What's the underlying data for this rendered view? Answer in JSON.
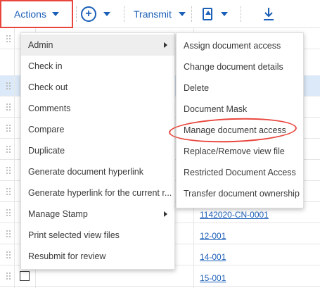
{
  "toolbar": {
    "actions_label": "Actions",
    "transmit_label": "Transmit"
  },
  "grid": {
    "document_links": [
      "1142020-CN-0001",
      "12-001",
      "14-001",
      "15-001"
    ]
  },
  "actions_menu": {
    "items": [
      {
        "label": "Admin"
      },
      {
        "label": "Check in"
      },
      {
        "label": "Check out"
      },
      {
        "label": "Comments"
      },
      {
        "label": "Compare"
      },
      {
        "label": "Duplicate"
      },
      {
        "label": "Generate document hyperlink"
      },
      {
        "label": "Generate hyperlink for the current r..."
      },
      {
        "label": "Manage Stamp"
      },
      {
        "label": "Print selected view files"
      },
      {
        "label": "Resubmit for review"
      }
    ]
  },
  "admin_submenu": {
    "items": [
      {
        "label": "Assign document access"
      },
      {
        "label": "Change document details"
      },
      {
        "label": "Delete"
      },
      {
        "label": "Document Mask"
      },
      {
        "label": "Manage document access"
      },
      {
        "label": "Replace/Remove view file"
      },
      {
        "label": "Restricted Document Access"
      },
      {
        "label": "Transfer document ownership"
      }
    ]
  },
  "colors": {
    "accent": "#1b5fb8",
    "highlight_annotation": "#e8453c",
    "selected_row": "#dce9f8"
  }
}
